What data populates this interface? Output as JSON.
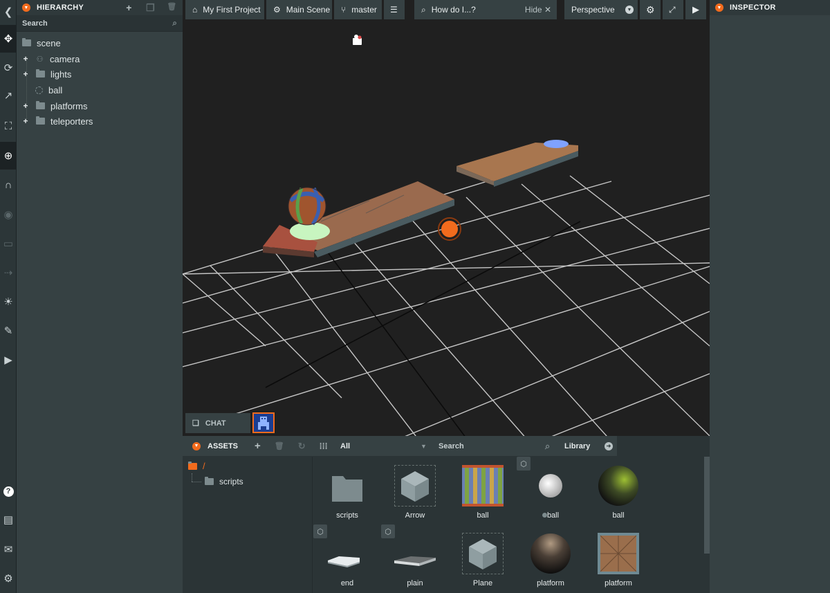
{
  "toolbar": {
    "tools": [
      {
        "name": "logo-icon",
        "glyph": "❮"
      },
      {
        "name": "translate-icon",
        "glyph": "✥"
      },
      {
        "name": "rotate-icon",
        "glyph": "⟳"
      },
      {
        "name": "scale-icon",
        "glyph": "↗"
      },
      {
        "name": "resize-icon",
        "glyph": "⛶"
      },
      {
        "name": "world-space-icon",
        "glyph": "⊕"
      },
      {
        "name": "snap-icon",
        "glyph": "∩"
      },
      {
        "name": "focus-icon",
        "glyph": "◉"
      },
      {
        "name": "undo-icon",
        "glyph": "▭"
      },
      {
        "name": "redo-icon",
        "glyph": "⇢"
      },
      {
        "name": "lightmapper-icon",
        "glyph": "☀"
      },
      {
        "name": "code-editor-icon",
        "glyph": "✎"
      },
      {
        "name": "publish-icon",
        "glyph": "▶"
      }
    ],
    "bottom_tools": [
      {
        "name": "help-icon",
        "glyph": "?"
      },
      {
        "name": "controls-icon",
        "glyph": "▤"
      },
      {
        "name": "feedback-icon",
        "glyph": "✉"
      },
      {
        "name": "settings-icon",
        "glyph": "⚙"
      }
    ]
  },
  "hierarchy": {
    "title": "HIERARCHY",
    "add_icon": "+",
    "duplicate_icon": "❐",
    "delete_icon": "🗑",
    "search_placeholder": "Search",
    "items": [
      {
        "label": "scene",
        "depth": 0,
        "expandable": false,
        "icon": "folder-icon"
      },
      {
        "label": "camera",
        "depth": 1,
        "expandable": true,
        "icon": "camera-entity-icon"
      },
      {
        "label": "lights",
        "depth": 1,
        "expandable": true,
        "icon": "folder-icon"
      },
      {
        "label": "ball",
        "depth": 1,
        "expandable": false,
        "icon": "entity-icon"
      },
      {
        "label": "platforms",
        "depth": 1,
        "expandable": true,
        "icon": "folder-icon"
      },
      {
        "label": "teleporters",
        "depth": 1,
        "expandable": true,
        "icon": "folder-icon"
      }
    ]
  },
  "topbar": {
    "project": "My First Project",
    "scene": "Main Scene",
    "branch": "master",
    "howdoi": "How do I...?",
    "hide": "Hide",
    "camera": "Perspective"
  },
  "chat": {
    "label": "CHAT"
  },
  "assets": {
    "title": "ASSETS",
    "filter": "All",
    "search_placeholder": "Search",
    "library": "Library",
    "tree": [
      {
        "label": "/",
        "root": true
      },
      {
        "label": "scripts",
        "root": false
      }
    ],
    "items": [
      {
        "label": "scripts",
        "kind": "folder"
      },
      {
        "label": "Arrow",
        "kind": "template"
      },
      {
        "label": "ball",
        "kind": "texture-stripes"
      },
      {
        "label": "ball",
        "kind": "material-white",
        "badge": true,
        "dot": true
      },
      {
        "label": "ball",
        "kind": "material-green"
      },
      {
        "label": "end",
        "kind": "model-plate",
        "badge": true
      },
      {
        "label": "plain",
        "kind": "model-plate-dark",
        "badge": true
      },
      {
        "label": "Plane",
        "kind": "template"
      },
      {
        "label": "platform",
        "kind": "material-dark"
      },
      {
        "label": "platform",
        "kind": "texture-wood"
      }
    ]
  },
  "inspector": {
    "title": "INSPECTOR"
  },
  "colors": {
    "accent": "#f26b1d",
    "panel": "#364143",
    "viewport": "#202020"
  }
}
